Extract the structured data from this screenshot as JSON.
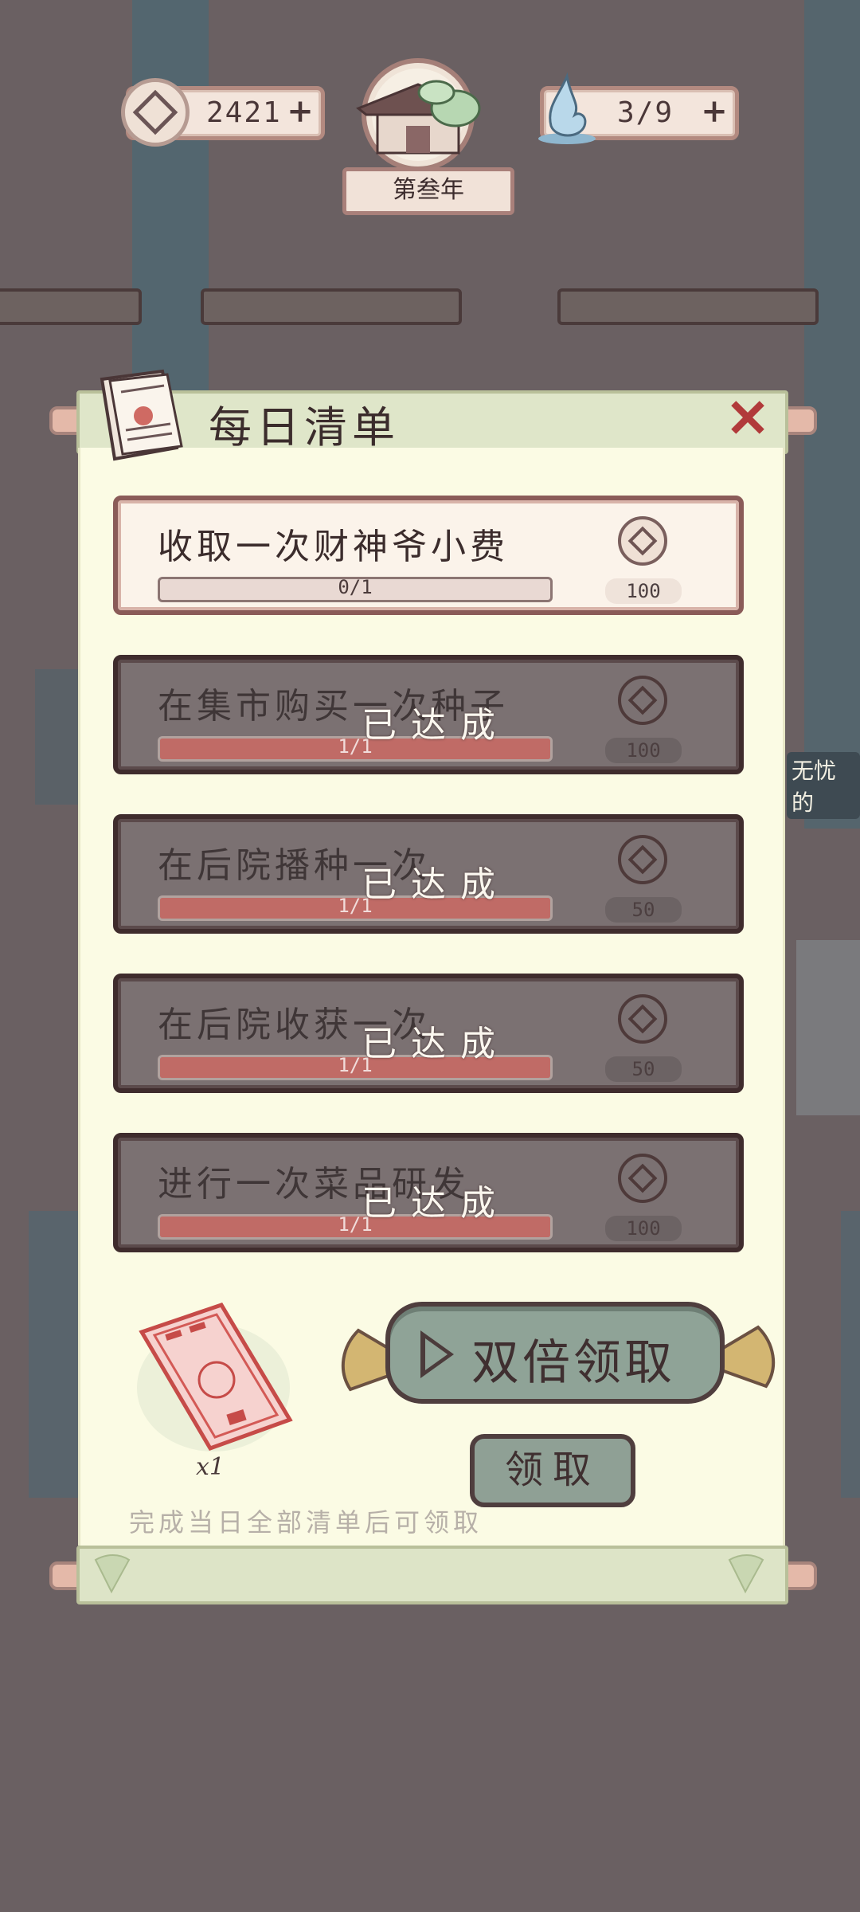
{
  "hud": {
    "coins": "2421",
    "spirit": "3/9",
    "year": "第叁年"
  },
  "panel": {
    "title": "每日清单"
  },
  "tasks": [
    {
      "name": "收取一次财神爷小费",
      "progress": "0/1",
      "reward": "100",
      "done": false,
      "fill": 0
    },
    {
      "name": "在集市购买一次种子",
      "progress": "1/1",
      "reward": "100",
      "done": true,
      "fill": 1
    },
    {
      "name": "在后院播种一次",
      "progress": "1/1",
      "reward": "50",
      "done": true,
      "fill": 1
    },
    {
      "name": "在后院收获一次",
      "progress": "1/1",
      "reward": "50",
      "done": true,
      "fill": 1
    },
    {
      "name": "进行一次菜品研发",
      "progress": "1/1",
      "reward": "100",
      "done": true,
      "fill": 1
    }
  ],
  "done_label": "已达成",
  "footer": {
    "ticket_count": "x1",
    "double_label": "双倍领取",
    "claim_label": "领取",
    "hint": "完成当日全部清单后可领取"
  },
  "background": {
    "side_label": "无忧的"
  },
  "colors": {
    "panel_bg": "#fbfbe4",
    "done_card": "#7b7172",
    "progress_fill": "#c06b66",
    "button_green": "#8fa397",
    "close_red": "#b13a3a"
  }
}
